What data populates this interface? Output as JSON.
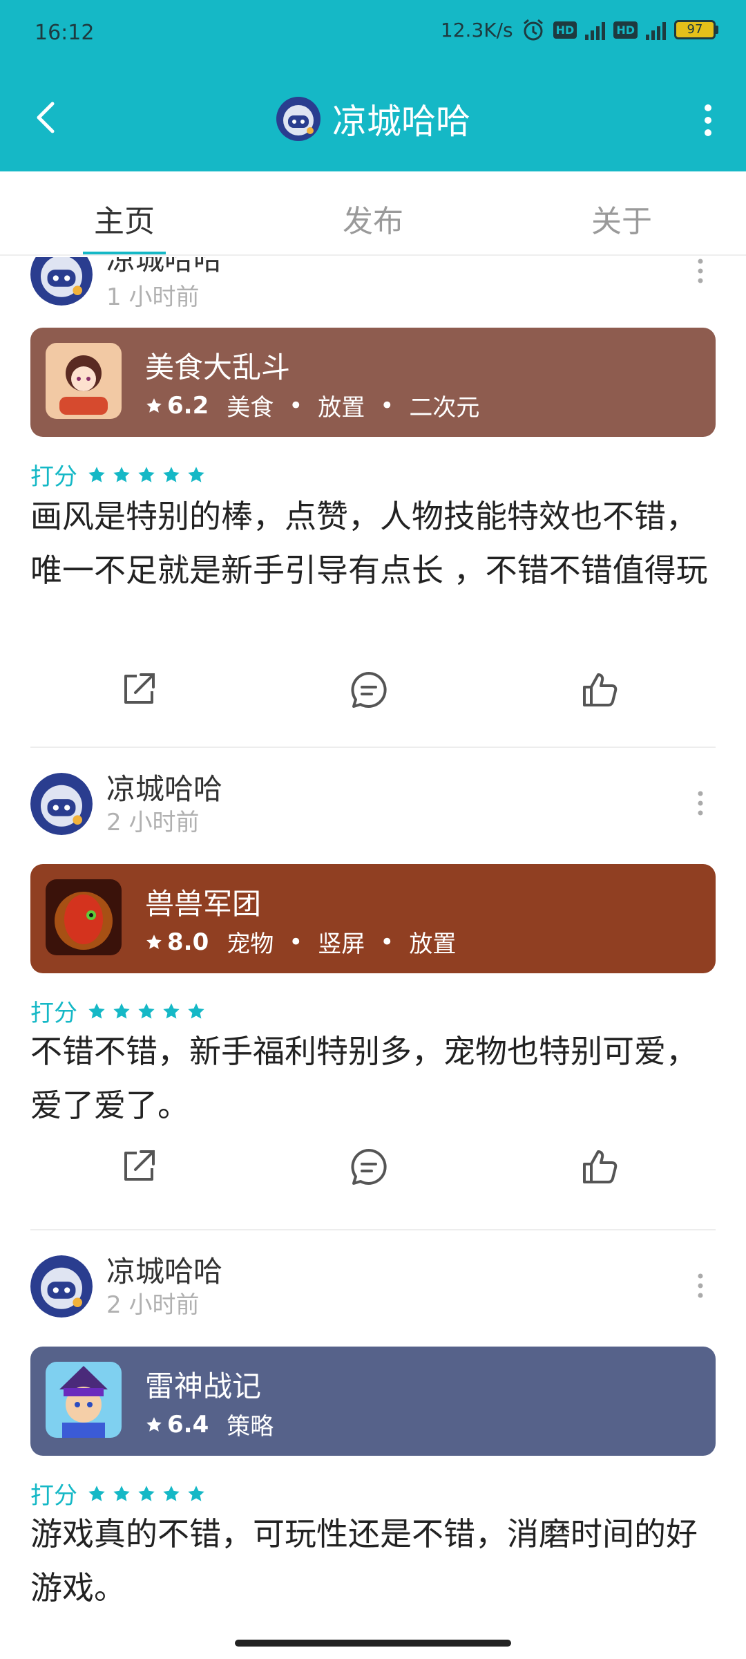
{
  "status_bar": {
    "time": "16:12",
    "net_speed": "12.3K/s",
    "hd1": "HD",
    "hd2": "HD",
    "net1": "4G",
    "net2": "4G",
    "battery": "97"
  },
  "appbar": {
    "title": "凉城哈哈",
    "accent": "#15b8c6"
  },
  "tabs": [
    {
      "label": "主页"
    },
    {
      "label": "发布"
    },
    {
      "label": "关于"
    }
  ],
  "posts": [
    {
      "user": "凉城哈哈",
      "time_ago": "1 小时前",
      "game": {
        "name": "美食大乱斗",
        "score": "6.2",
        "tags": [
          "美食",
          "放置",
          "二次元"
        ],
        "color": "#8e5c4f"
      },
      "rate_label": "打分",
      "stars": 5,
      "comment": "画风是特别的棒，点赞，人物技能特效也不错，唯一不足就是新手引导有点长 ，不错不错值得玩"
    },
    {
      "user": "凉城哈哈",
      "time_ago": "2 小时前",
      "game": {
        "name": "兽兽军团",
        "score": "8.0",
        "tags": [
          "宠物",
          "竖屏",
          "放置"
        ],
        "color": "#903f22"
      },
      "rate_label": "打分",
      "stars": 5,
      "comment": "不错不错，新手福利特别多，宠物也特别可爱，爱了爱了。"
    },
    {
      "user": "凉城哈哈",
      "time_ago": "2 小时前",
      "game": {
        "name": "雷神战记",
        "score": "6.4",
        "tags": [
          "策略"
        ],
        "color": "#56628a"
      },
      "rate_label": "打分",
      "stars": 5,
      "comment": "游戏真的不错，可玩性还是不错，消磨时间的好游戏。"
    }
  ]
}
